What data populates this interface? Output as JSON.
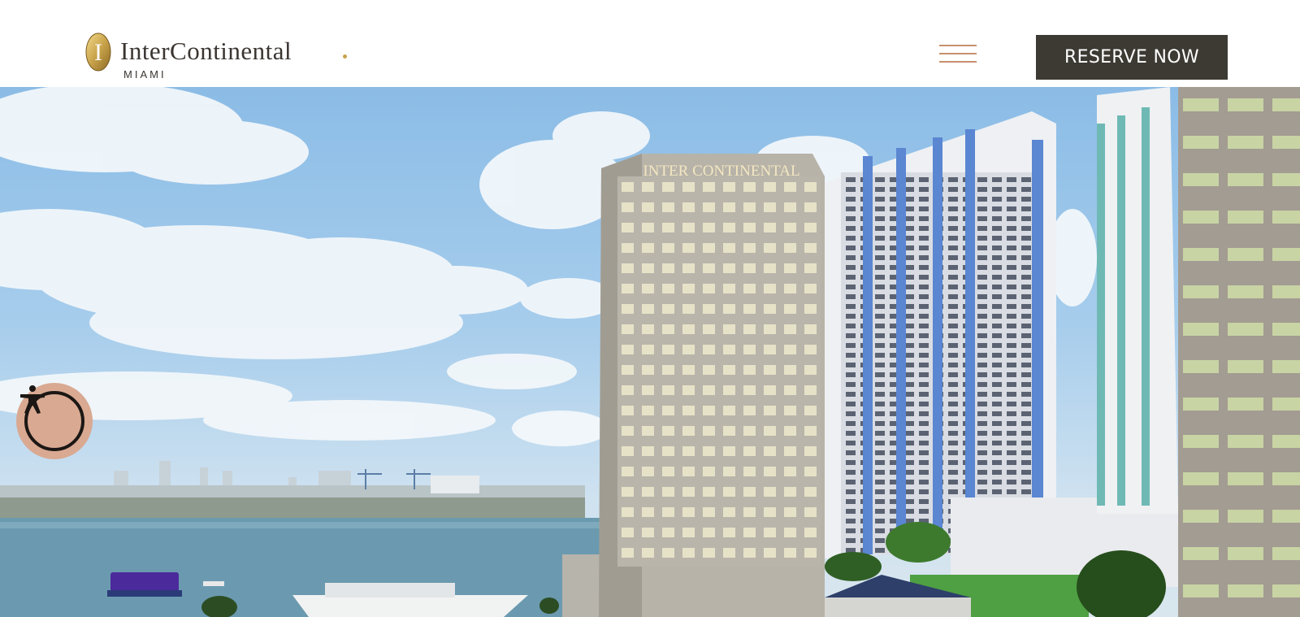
{
  "header": {
    "logo": {
      "name": "InterContinental",
      "location": "MIAMI"
    },
    "menu_icon": "hamburger-menu-icon",
    "reserve_label": "RESERVE NOW"
  },
  "hero": {
    "building_sign": "INTER CONTINENTAL",
    "accessibility_icon": "accessibility-person-icon"
  },
  "colors": {
    "header_bg": "#ffffff",
    "button_bg": "#3d3a33",
    "menu_accent": "#c8906c",
    "logo_gold": "#c9a34b",
    "accessibility_bg": "#d9a992"
  }
}
